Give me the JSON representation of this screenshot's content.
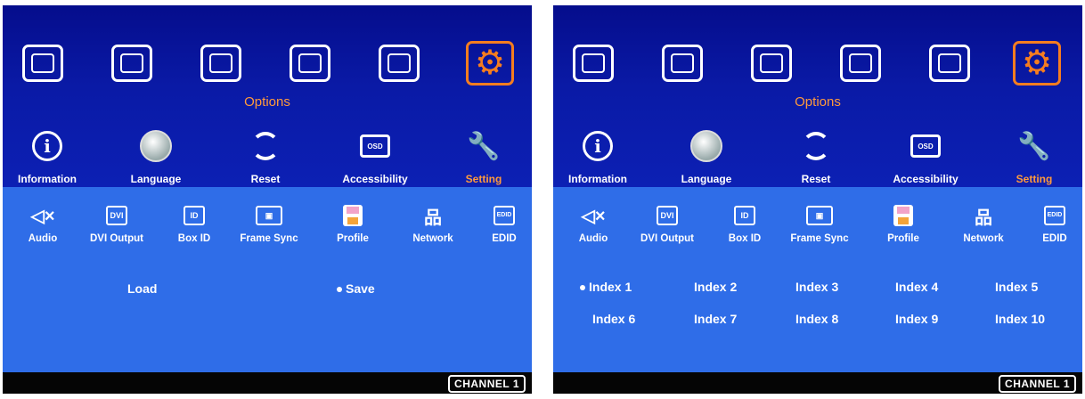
{
  "menu": {
    "section_title": "Options",
    "categories": [
      "color-palette-icon",
      "pattern-icon",
      "globe-grid-icon",
      "cube-icon",
      "projector-icon",
      "gear-icon"
    ],
    "options": [
      {
        "label": "Information",
        "icon": "info-icon"
      },
      {
        "label": "Language",
        "icon": "globe-icon"
      },
      {
        "label": "Reset",
        "icon": "reset-icon"
      },
      {
        "label": "Accessibility",
        "icon": "osd-icon"
      },
      {
        "label": "Setting",
        "icon": "tools-icon"
      }
    ],
    "sub_items": [
      {
        "label": "Audio",
        "icon": "mute-icon"
      },
      {
        "label": "DVI Output",
        "icon": "dvi-icon"
      },
      {
        "label": "Box ID",
        "icon": "id-icon"
      },
      {
        "label": "Frame Sync",
        "icon": "frame-sync-icon"
      },
      {
        "label": "Profile",
        "icon": "floppy-icon"
      },
      {
        "label": "Network",
        "icon": "network-icon"
      },
      {
        "label": "EDID",
        "icon": "edid-icon"
      }
    ],
    "channel": "CHANNEL 1"
  },
  "left_screen": {
    "choices": [
      {
        "label": "Load",
        "selected": false
      },
      {
        "label": "Save",
        "selected": true
      }
    ]
  },
  "right_screen": {
    "indexes": [
      {
        "label": "Index 1",
        "selected": true
      },
      {
        "label": "Index 2",
        "selected": false
      },
      {
        "label": "Index 3",
        "selected": false
      },
      {
        "label": "Index 4",
        "selected": false
      },
      {
        "label": "Index 5",
        "selected": false
      },
      {
        "label": "Index 6",
        "selected": false
      },
      {
        "label": "Index 7",
        "selected": false
      },
      {
        "label": "Index 8",
        "selected": false
      },
      {
        "label": "Index 9",
        "selected": false
      },
      {
        "label": "Index 10",
        "selected": false
      }
    ]
  },
  "colors": {
    "top_background": "#0a1aa6",
    "bottom_background": "#2f6de8",
    "highlight": "#f57d1f",
    "active_text": "#ff9a3c"
  }
}
